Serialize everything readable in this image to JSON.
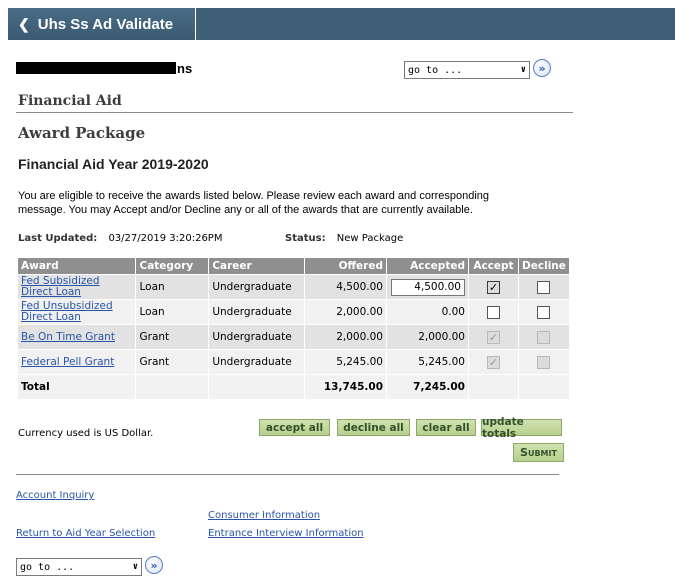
{
  "header": {
    "back_label": "Uhs Ss Ad Validate"
  },
  "user": {
    "name_tail": "ns"
  },
  "goto": {
    "label": "go to ..."
  },
  "section_title": "Financial Aid",
  "page_title": "Award Package",
  "aid_year_heading": "Financial Aid Year 2019-2020",
  "intro_line1": "You are eligible to receive the awards listed below. Please review each award and corresponding",
  "intro_line2": "message. You may Accept and/or Decline any or all of the awards that are currently available.",
  "meta": {
    "last_updated_label": "Last Updated:",
    "last_updated_value": "03/27/2019  3:20:26PM",
    "status_label": "Status:",
    "status_value": "New Package"
  },
  "table": {
    "headers": [
      "Award",
      "Category",
      "Career",
      "Offered",
      "Accepted",
      "Accept",
      "Decline"
    ],
    "rows": [
      {
        "award_line1": "Fed Subsidized",
        "award_line2": "Direct Loan",
        "category": "Loan",
        "career": "Undergraduate",
        "offered": "4,500.00",
        "accepted": "4,500.00",
        "accept_checked": true,
        "decline_checked": false
      },
      {
        "award_line1": "Fed Unsubsidized",
        "award_line2": "Direct Loan",
        "category": "Loan",
        "career": "Undergraduate",
        "offered": "2,000.00",
        "accepted": "0.00",
        "accept_checked": false,
        "decline_checked": false
      },
      {
        "award_line1": "Be On Time Grant",
        "award_line2": "",
        "category": "Grant",
        "career": "Undergraduate",
        "offered": "2,000.00",
        "accepted": "2,000.00",
        "accept_checked": true,
        "decline_checked": false
      },
      {
        "award_line1": "Federal Pell Grant",
        "award_line2": "",
        "category": "Grant",
        "career": "Undergraduate",
        "offered": "5,245.00",
        "accepted": "5,245.00",
        "accept_checked": true,
        "decline_checked": false
      }
    ],
    "total_label": "Total",
    "total_offered": "13,745.00",
    "total_accepted": "7,245.00"
  },
  "currency_note": "Currency used is US Dollar.",
  "buttons": {
    "accept_all": "accept all",
    "decline_all": "decline all",
    "clear_all": "clear all",
    "update_totals": "update totals",
    "submit": "Submit"
  },
  "footer_links": {
    "account_inquiry": "Account Inquiry",
    "consumer_information": "Consumer Information",
    "return_to_aid_year": "Return to Aid Year Selection",
    "entrance_interview": "Entrance Interview Information"
  },
  "checkmark": "✓"
}
